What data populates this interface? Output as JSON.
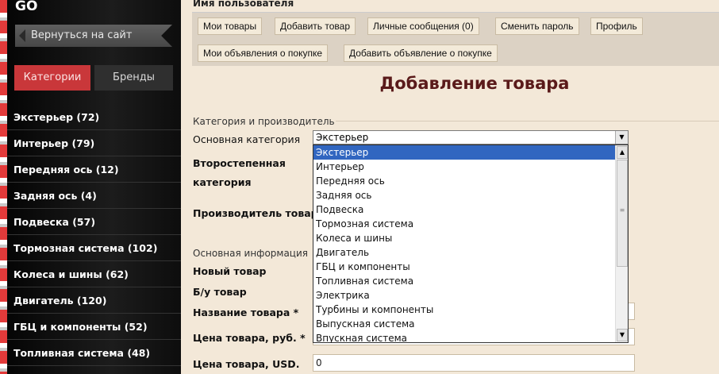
{
  "sidebar": {
    "logo": "GO",
    "back_label": "Вернуться на сайт",
    "tabs": [
      {
        "label": "Категории"
      },
      {
        "label": "Бренды"
      }
    ],
    "categories": [
      {
        "label": "Экстерьер (72)"
      },
      {
        "label": "Интерьер (79)"
      },
      {
        "label": "Передняя ось (12)"
      },
      {
        "label": "Задняя ось (4)"
      },
      {
        "label": "Подвеска (57)"
      },
      {
        "label": "Тормозная система (102)"
      },
      {
        "label": "Колеса и шины (62)"
      },
      {
        "label": "Двигатель (120)"
      },
      {
        "label": "ГБЦ и компоненты (52)"
      },
      {
        "label": "Топливная система (48)"
      }
    ]
  },
  "header": {
    "user_name": "Имя пользователя",
    "menu": [
      {
        "label": "Мои товары"
      },
      {
        "label": "Добавить товар"
      },
      {
        "label": "Личные сообщения (0)"
      },
      {
        "label": "Сменить пароль"
      },
      {
        "label": "Профиль"
      },
      {
        "label": "Мои объявления о покупке"
      },
      {
        "label": "Добавить объявление о покупке"
      }
    ]
  },
  "main": {
    "page_title": "Добавление товара",
    "section1": "Категория и производитель",
    "main_category_label": "Основная категория",
    "secondary_category_label_1": "Второстепенная",
    "secondary_category_label_2": "категория",
    "manufacturer_label": "Производитель товара",
    "main_category_value": "Экстерьер",
    "dropdown_options": [
      "Экстерьер",
      "Интерьер",
      "Передняя ось",
      "Задняя ось",
      "Подвеска",
      "Тормозная система",
      "Колеса и шины",
      "Двигатель",
      "ГБЦ и компоненты",
      "Топливная система",
      "Электрика",
      "Турбины и компоненты",
      "Выпускная система",
      "Впускная система"
    ],
    "section2": "Основная информация",
    "new_label": "Новый товар",
    "used_label": "Б/у товар",
    "name_label": "Название товара *",
    "price_rub_label": "Цена товара, руб. *",
    "price_usd_label": "Цена товара, USD.",
    "price_usd_value": "0"
  }
}
